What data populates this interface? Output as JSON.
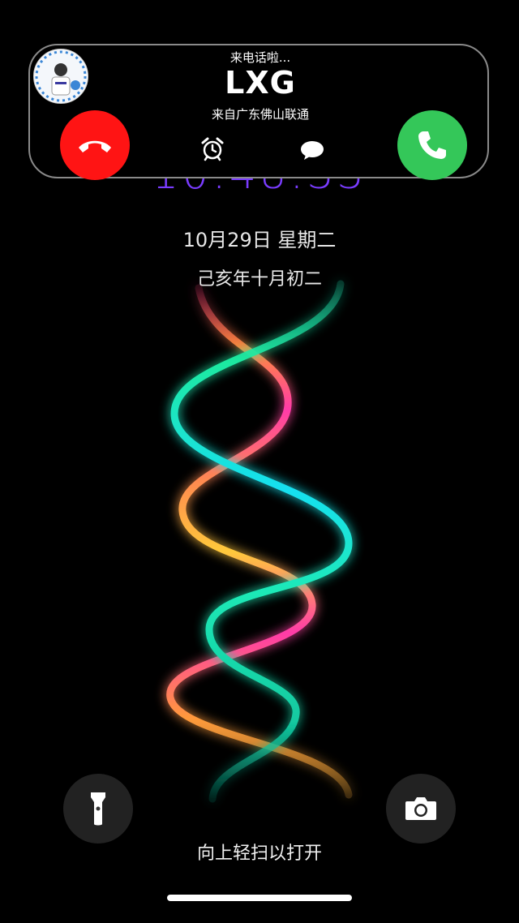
{
  "incoming_call": {
    "status": "来电话啦...",
    "caller": "LXG",
    "location": "来自广东佛山联通",
    "decline_icon": "phone-hangup-icon",
    "accept_icon": "phone-icon",
    "remind_icon": "alarm-clock-icon",
    "message_icon": "speech-bubble-icon"
  },
  "lockscreen": {
    "time": "10:48:33",
    "date": "10月29日 星期二",
    "lunar_date": "己亥年十月初二"
  },
  "bottom": {
    "flashlight_icon": "flashlight-icon",
    "camera_icon": "camera-icon",
    "swipe_hint": "向上轻扫以打开"
  },
  "colors": {
    "decline": "#ff1414",
    "accept": "#34c759",
    "time": "#7a3cff"
  }
}
